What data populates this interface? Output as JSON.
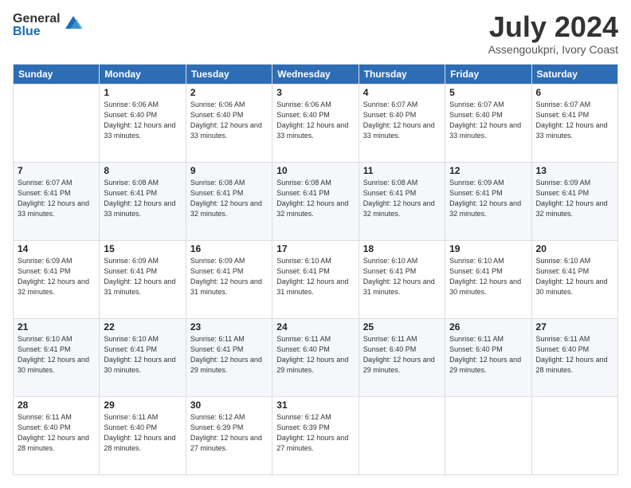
{
  "logo": {
    "general": "General",
    "blue": "Blue"
  },
  "header": {
    "month": "July 2024",
    "location": "Assengoukpri, Ivory Coast"
  },
  "weekdays": [
    "Sunday",
    "Monday",
    "Tuesday",
    "Wednesday",
    "Thursday",
    "Friday",
    "Saturday"
  ],
  "weeks": [
    [
      {
        "day": "",
        "sunrise": "",
        "sunset": "",
        "daylight": ""
      },
      {
        "day": "1",
        "sunrise": "Sunrise: 6:06 AM",
        "sunset": "Sunset: 6:40 PM",
        "daylight": "Daylight: 12 hours and 33 minutes."
      },
      {
        "day": "2",
        "sunrise": "Sunrise: 6:06 AM",
        "sunset": "Sunset: 6:40 PM",
        "daylight": "Daylight: 12 hours and 33 minutes."
      },
      {
        "day": "3",
        "sunrise": "Sunrise: 6:06 AM",
        "sunset": "Sunset: 6:40 PM",
        "daylight": "Daylight: 12 hours and 33 minutes."
      },
      {
        "day": "4",
        "sunrise": "Sunrise: 6:07 AM",
        "sunset": "Sunset: 6:40 PM",
        "daylight": "Daylight: 12 hours and 33 minutes."
      },
      {
        "day": "5",
        "sunrise": "Sunrise: 6:07 AM",
        "sunset": "Sunset: 6:40 PM",
        "daylight": "Daylight: 12 hours and 33 minutes."
      },
      {
        "day": "6",
        "sunrise": "Sunrise: 6:07 AM",
        "sunset": "Sunset: 6:41 PM",
        "daylight": "Daylight: 12 hours and 33 minutes."
      }
    ],
    [
      {
        "day": "7",
        "sunrise": "Sunrise: 6:07 AM",
        "sunset": "Sunset: 6:41 PM",
        "daylight": "Daylight: 12 hours and 33 minutes."
      },
      {
        "day": "8",
        "sunrise": "Sunrise: 6:08 AM",
        "sunset": "Sunset: 6:41 PM",
        "daylight": "Daylight: 12 hours and 33 minutes."
      },
      {
        "day": "9",
        "sunrise": "Sunrise: 6:08 AM",
        "sunset": "Sunset: 6:41 PM",
        "daylight": "Daylight: 12 hours and 32 minutes."
      },
      {
        "day": "10",
        "sunrise": "Sunrise: 6:08 AM",
        "sunset": "Sunset: 6:41 PM",
        "daylight": "Daylight: 12 hours and 32 minutes."
      },
      {
        "day": "11",
        "sunrise": "Sunrise: 6:08 AM",
        "sunset": "Sunset: 6:41 PM",
        "daylight": "Daylight: 12 hours and 32 minutes."
      },
      {
        "day": "12",
        "sunrise": "Sunrise: 6:09 AM",
        "sunset": "Sunset: 6:41 PM",
        "daylight": "Daylight: 12 hours and 32 minutes."
      },
      {
        "day": "13",
        "sunrise": "Sunrise: 6:09 AM",
        "sunset": "Sunset: 6:41 PM",
        "daylight": "Daylight: 12 hours and 32 minutes."
      }
    ],
    [
      {
        "day": "14",
        "sunrise": "Sunrise: 6:09 AM",
        "sunset": "Sunset: 6:41 PM",
        "daylight": "Daylight: 12 hours and 32 minutes."
      },
      {
        "day": "15",
        "sunrise": "Sunrise: 6:09 AM",
        "sunset": "Sunset: 6:41 PM",
        "daylight": "Daylight: 12 hours and 31 minutes."
      },
      {
        "day": "16",
        "sunrise": "Sunrise: 6:09 AM",
        "sunset": "Sunset: 6:41 PM",
        "daylight": "Daylight: 12 hours and 31 minutes."
      },
      {
        "day": "17",
        "sunrise": "Sunrise: 6:10 AM",
        "sunset": "Sunset: 6:41 PM",
        "daylight": "Daylight: 12 hours and 31 minutes."
      },
      {
        "day": "18",
        "sunrise": "Sunrise: 6:10 AM",
        "sunset": "Sunset: 6:41 PM",
        "daylight": "Daylight: 12 hours and 31 minutes."
      },
      {
        "day": "19",
        "sunrise": "Sunrise: 6:10 AM",
        "sunset": "Sunset: 6:41 PM",
        "daylight": "Daylight: 12 hours and 30 minutes."
      },
      {
        "day": "20",
        "sunrise": "Sunrise: 6:10 AM",
        "sunset": "Sunset: 6:41 PM",
        "daylight": "Daylight: 12 hours and 30 minutes."
      }
    ],
    [
      {
        "day": "21",
        "sunrise": "Sunrise: 6:10 AM",
        "sunset": "Sunset: 6:41 PM",
        "daylight": "Daylight: 12 hours and 30 minutes."
      },
      {
        "day": "22",
        "sunrise": "Sunrise: 6:10 AM",
        "sunset": "Sunset: 6:41 PM",
        "daylight": "Daylight: 12 hours and 30 minutes."
      },
      {
        "day": "23",
        "sunrise": "Sunrise: 6:11 AM",
        "sunset": "Sunset: 6:41 PM",
        "daylight": "Daylight: 12 hours and 29 minutes."
      },
      {
        "day": "24",
        "sunrise": "Sunrise: 6:11 AM",
        "sunset": "Sunset: 6:40 PM",
        "daylight": "Daylight: 12 hours and 29 minutes."
      },
      {
        "day": "25",
        "sunrise": "Sunrise: 6:11 AM",
        "sunset": "Sunset: 6:40 PM",
        "daylight": "Daylight: 12 hours and 29 minutes."
      },
      {
        "day": "26",
        "sunrise": "Sunrise: 6:11 AM",
        "sunset": "Sunset: 6:40 PM",
        "daylight": "Daylight: 12 hours and 29 minutes."
      },
      {
        "day": "27",
        "sunrise": "Sunrise: 6:11 AM",
        "sunset": "Sunset: 6:40 PM",
        "daylight": "Daylight: 12 hours and 28 minutes."
      }
    ],
    [
      {
        "day": "28",
        "sunrise": "Sunrise: 6:11 AM",
        "sunset": "Sunset: 6:40 PM",
        "daylight": "Daylight: 12 hours and 28 minutes."
      },
      {
        "day": "29",
        "sunrise": "Sunrise: 6:11 AM",
        "sunset": "Sunset: 6:40 PM",
        "daylight": "Daylight: 12 hours and 28 minutes."
      },
      {
        "day": "30",
        "sunrise": "Sunrise: 6:12 AM",
        "sunset": "Sunset: 6:39 PM",
        "daylight": "Daylight: 12 hours and 27 minutes."
      },
      {
        "day": "31",
        "sunrise": "Sunrise: 6:12 AM",
        "sunset": "Sunset: 6:39 PM",
        "daylight": "Daylight: 12 hours and 27 minutes."
      },
      {
        "day": "",
        "sunrise": "",
        "sunset": "",
        "daylight": ""
      },
      {
        "day": "",
        "sunrise": "",
        "sunset": "",
        "daylight": ""
      },
      {
        "day": "",
        "sunrise": "",
        "sunset": "",
        "daylight": ""
      }
    ]
  ]
}
